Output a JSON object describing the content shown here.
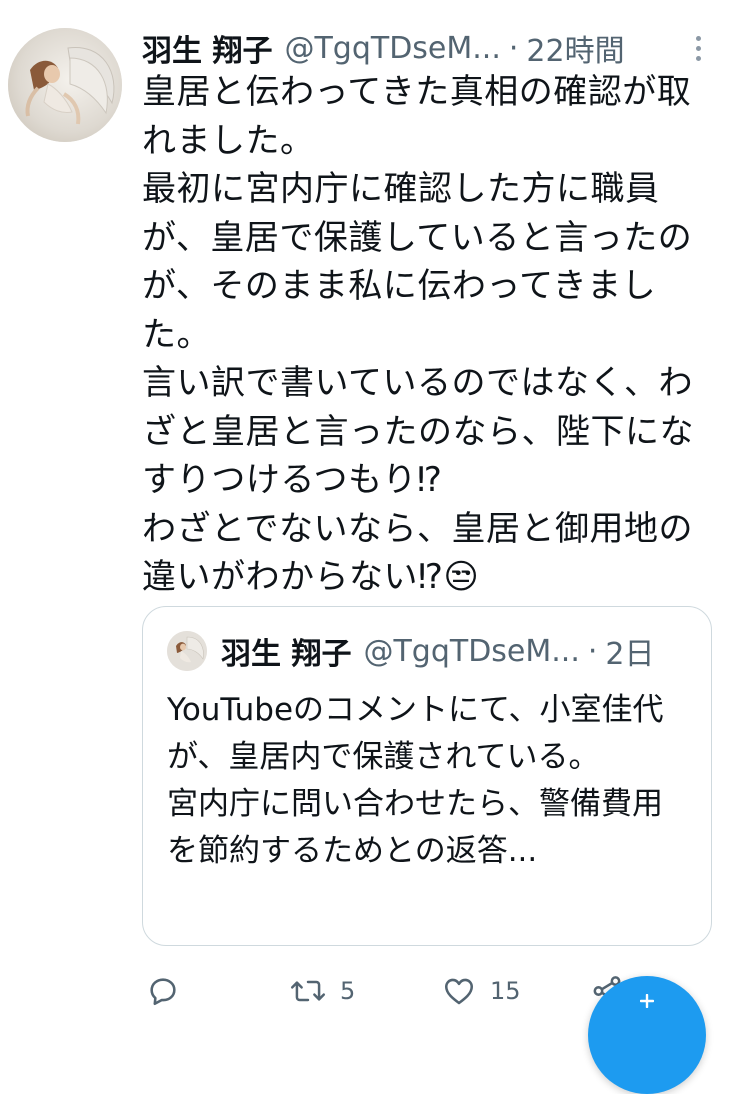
{
  "tweet": {
    "author_name": "羽生 翔子",
    "handle": "@TgqTDseM...",
    "separator": "·",
    "time": "22時間",
    "text": "皇居と伝わってきた真相の確認が取れました。\n最初に宮内庁に確認した方に職員が、皇居で保護していると言ったのが、そのまま私に伝わってきました。\n言い訳で書いているのではなく、わざと皇居と言ったのなら、陛下になすりつけるつもり⁉\nわざとでないなら、皇居と御用地の違いがわからない⁉😒"
  },
  "quote": {
    "author_name": "羽生 翔子",
    "handle": "@TgqTDseM...",
    "separator": "·",
    "time": "2日",
    "text": "YouTubeのコメントにて、小室佳代が、皇居内で保護されている。\n宮内庁に問い合わせたら、警備費用を節約するためとの返答..."
  },
  "actions": {
    "reply_icon": "reply-icon",
    "retweet_icon": "retweet-icon",
    "retweet_count": "5",
    "like_icon": "heart-icon",
    "like_count": "15",
    "share_icon": "share-icon"
  },
  "fab": {
    "icon": "plus-icon",
    "color": "#1d9bf0"
  },
  "colors": {
    "text": "#0f1419",
    "secondary": "#536471",
    "border": "#cfd9de",
    "accent": "#1d9bf0"
  }
}
